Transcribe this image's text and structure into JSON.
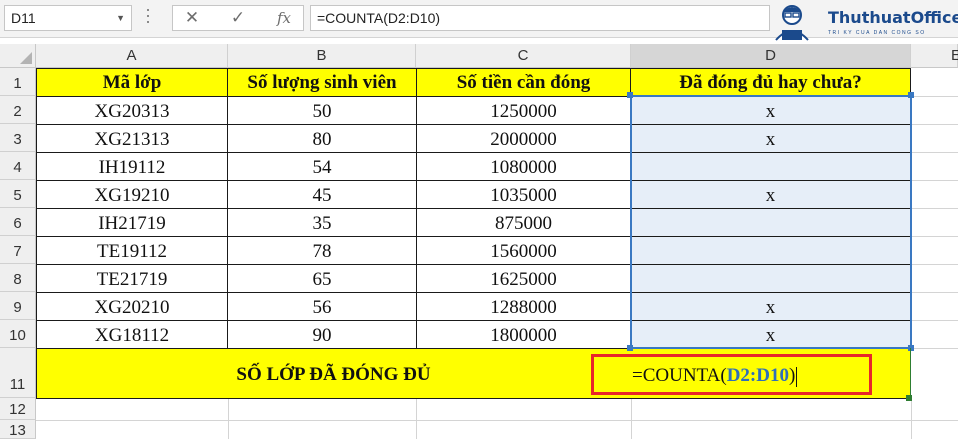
{
  "formula_bar": {
    "name_box": "D11",
    "cancel_glyph": "✕",
    "enter_glyph": "✓",
    "fx_label": "fx",
    "formula": "=COUNTA(D2:D10)"
  },
  "logo": {
    "brand": "ThuthuatOffice",
    "tagline": "TRI KY CUA DAN CONG SO"
  },
  "columns": [
    "A",
    "B",
    "C",
    "D",
    "E"
  ],
  "rows": [
    "1",
    "2",
    "3",
    "4",
    "5",
    "6",
    "7",
    "8",
    "9",
    "10",
    "11",
    "12",
    "13"
  ],
  "table": {
    "headers": [
      "Mã lớp",
      "Số lượng sinh viên",
      "Số tiền cần đóng",
      "Đã đóng đủ hay chưa?"
    ],
    "rows": [
      [
        "XG20313",
        "50",
        "1250000",
        "x"
      ],
      [
        "XG21313",
        "80",
        "2000000",
        "x"
      ],
      [
        "IH19112",
        "54",
        "1080000",
        ""
      ],
      [
        "XG19210",
        "45",
        "1035000",
        "x"
      ],
      [
        "IH21719",
        "35",
        "875000",
        ""
      ],
      [
        "TE19112",
        "78",
        "1560000",
        ""
      ],
      [
        "TE21719",
        "65",
        "1625000",
        ""
      ],
      [
        "XG20210",
        "56",
        "1288000",
        "x"
      ],
      [
        "XG18112",
        "90",
        "1800000",
        "x"
      ]
    ],
    "summary_label": "SỐ LỚP ĐÃ ĐÓNG ĐỦ",
    "formula_prefix": "=COUNTA(",
    "formula_ref": "D2:D10",
    "formula_suffix": ")"
  },
  "colors": {
    "header_fill": "#ffff00",
    "range_fill": "#e6eef8",
    "ref_blue": "#2f6fb9",
    "highlight_box": "#e8262a"
  }
}
